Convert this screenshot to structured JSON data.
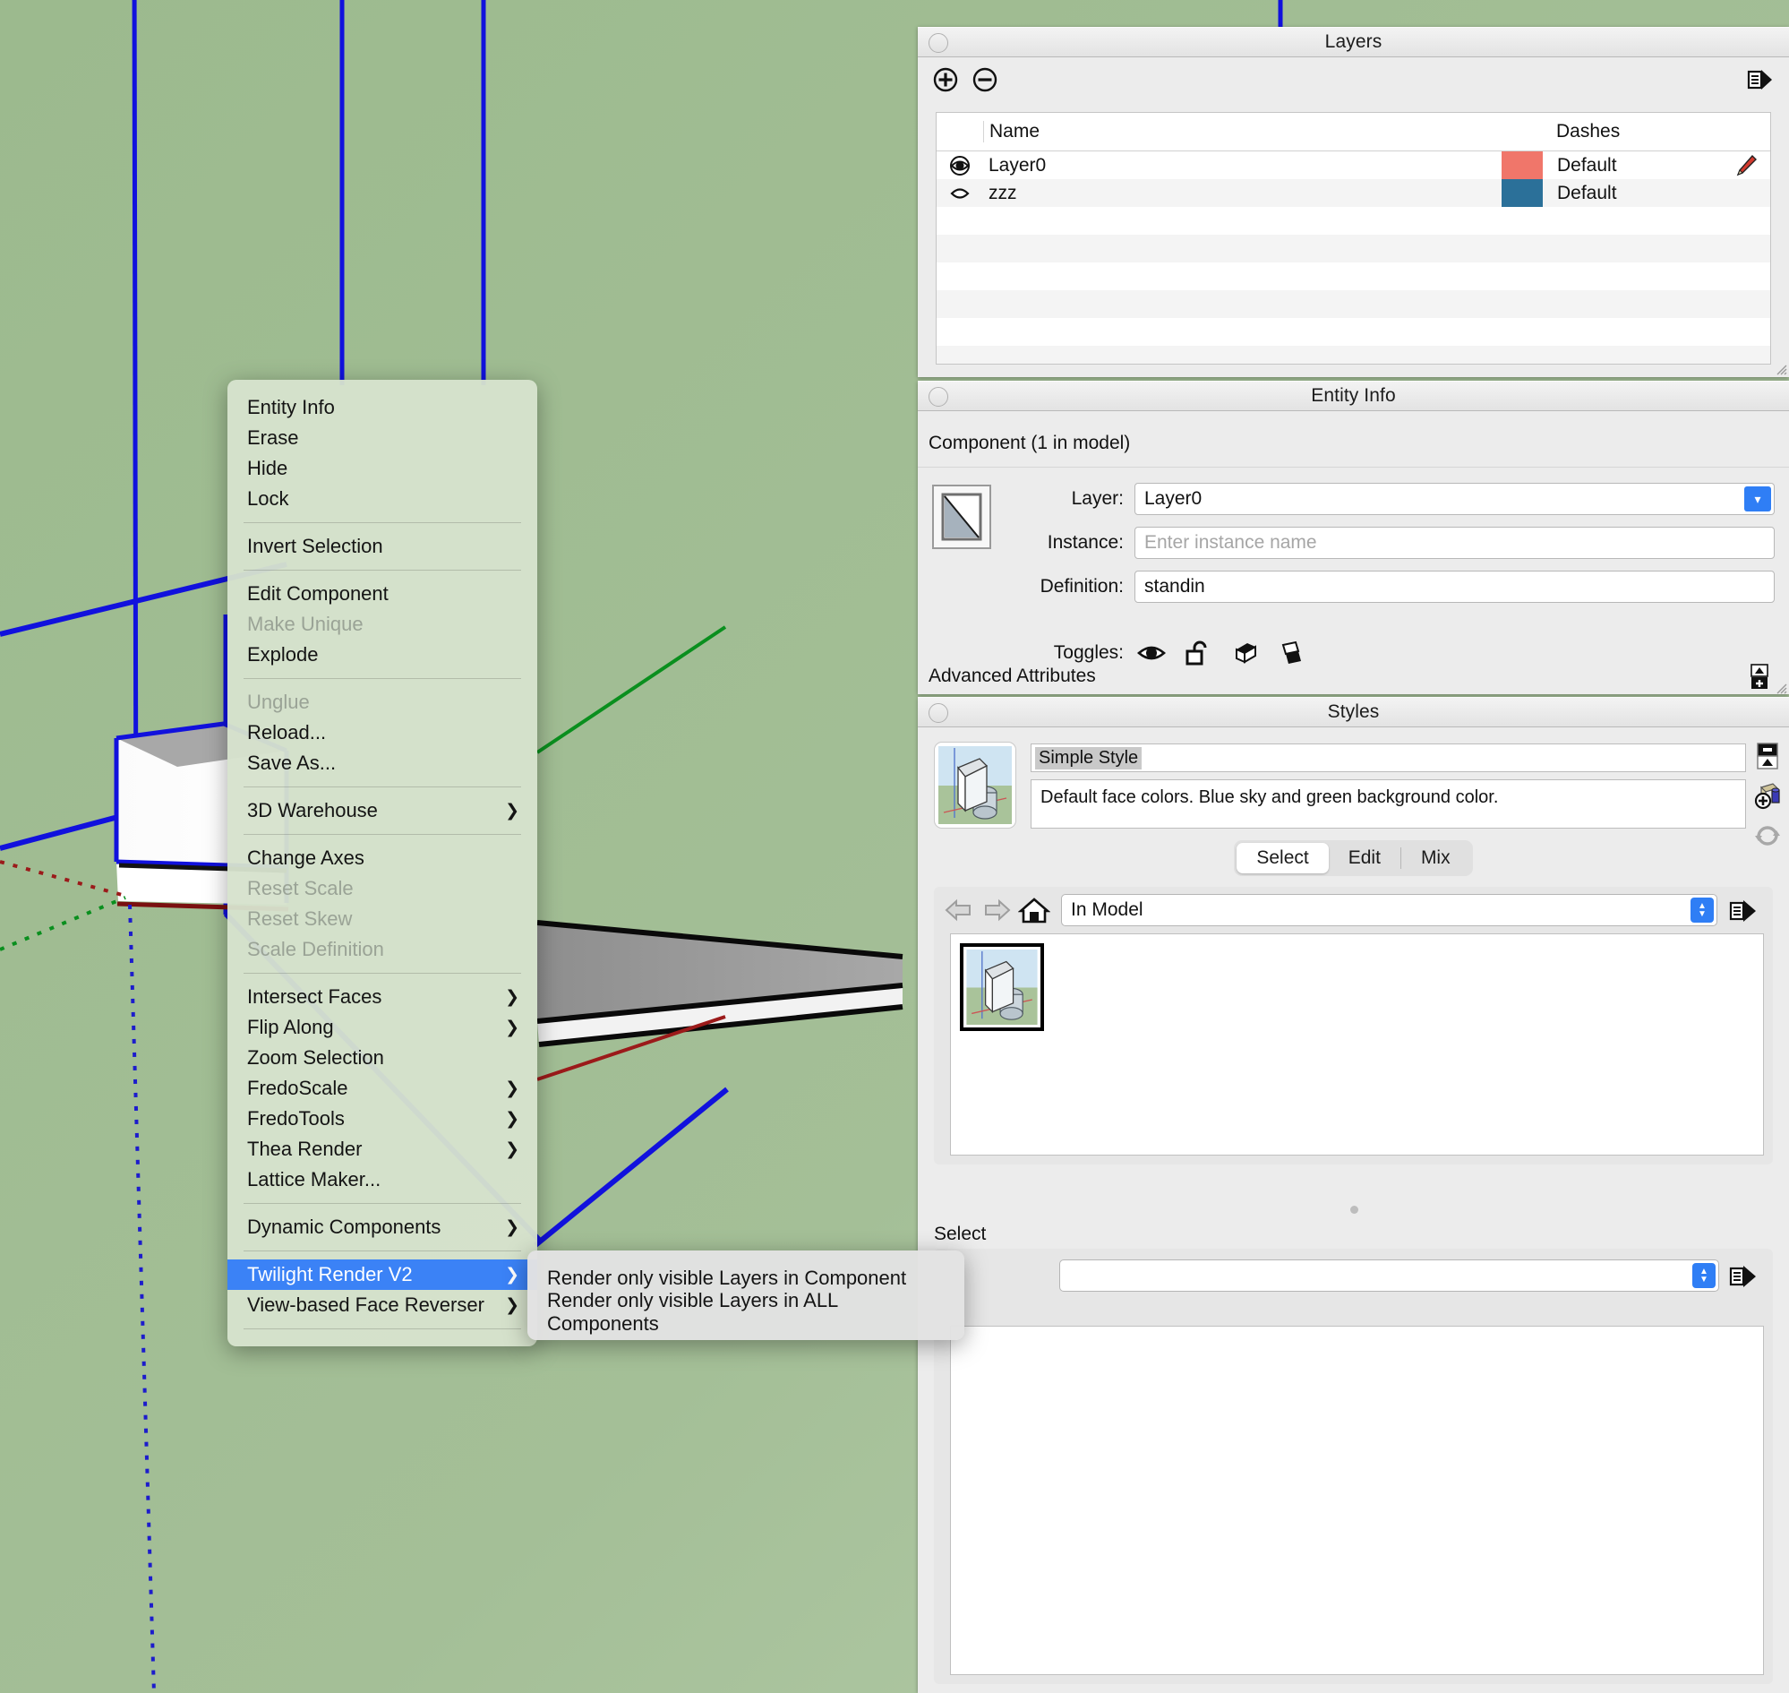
{
  "app": "SketchUp",
  "viewport": {
    "background_color": "#9cb98f",
    "selection_edge_color": "#0000ff",
    "axis_red": "#9b1a1a",
    "axis_green": "#0a8f1e",
    "axis_blue": "#1c1ccc"
  },
  "layers_panel": {
    "title": "Layers",
    "add_icon": "plus-circle-icon",
    "remove_icon": "minus-circle-icon",
    "options_icon": "list-options-icon",
    "columns": [
      "",
      "Name",
      "",
      "Dashes",
      ""
    ],
    "rows": [
      {
        "visible": true,
        "visibility_icon": "eye-filled-icon",
        "name": "Layer0",
        "color": "#f0766a",
        "dashes": "Default",
        "editing": true,
        "edit_icon": "pencil-icon"
      },
      {
        "visible": false,
        "visibility_icon": "eye-outline-icon",
        "name": "zzz",
        "color": "#2b7099",
        "dashes": "Default",
        "editing": false,
        "edit_icon": ""
      }
    ]
  },
  "entity_info_panel": {
    "title": "Entity Info",
    "type_label": "Component (1 in model)",
    "thumbnail_icon": "face-thumbnail-icon",
    "fields": [
      {
        "label": "Layer:",
        "value": "Layer0",
        "placeholder": "",
        "kind": "combo"
      },
      {
        "label": "Instance:",
        "value": "",
        "placeholder": "Enter instance name",
        "kind": "text"
      },
      {
        "label": "Definition:",
        "value": "standin",
        "placeholder": "",
        "kind": "text"
      }
    ],
    "toggles_label": "Toggles:",
    "toggles": [
      "eye-icon",
      "unlock-icon",
      "cast-shadows-icon",
      "receive-shadows-icon"
    ],
    "advanced_attributes_label": "Advanced Attributes",
    "advanced_expand_icon": "expand-collapse-icon"
  },
  "styles_panel": {
    "title": "Styles",
    "thumbnail_icon": "style-preview-icon",
    "style_name": "Simple Style",
    "style_description": "Default face colors. Blue sky and green background color.",
    "side_buttons": [
      "display-settings-icon",
      "create-style-icon",
      "update-style-icon"
    ],
    "tabs": [
      {
        "label": "Select",
        "active": true
      },
      {
        "label": "Edit",
        "active": false
      },
      {
        "label": "Mix",
        "active": false
      }
    ],
    "nav_icons": [
      "back-arrow-icon",
      "forward-arrow-icon",
      "home-icon"
    ],
    "collection": "In Model",
    "details_icon": "list-options-icon",
    "grid_items": [
      {
        "name": "Simple Style",
        "selected": true,
        "icon": "style-preview-icon"
      }
    ],
    "lower_section_label": "Select",
    "lower_select_value": "",
    "lower_details_icon": "list-options-icon"
  },
  "context_menu": {
    "items": [
      {
        "label": "Entity Info",
        "enabled": true,
        "submenu": false,
        "separator_after": false
      },
      {
        "label": "Erase",
        "enabled": true,
        "submenu": false,
        "separator_after": false
      },
      {
        "label": "Hide",
        "enabled": true,
        "submenu": false,
        "separator_after": false
      },
      {
        "label": "Lock",
        "enabled": true,
        "submenu": false,
        "separator_after": true
      },
      {
        "label": "Invert Selection",
        "enabled": true,
        "submenu": false,
        "separator_after": true
      },
      {
        "label": "Edit Component",
        "enabled": true,
        "submenu": false,
        "separator_after": false
      },
      {
        "label": "Make Unique",
        "enabled": false,
        "submenu": false,
        "separator_after": false
      },
      {
        "label": "Explode",
        "enabled": true,
        "submenu": false,
        "separator_after": true
      },
      {
        "label": "Unglue",
        "enabled": false,
        "submenu": false,
        "separator_after": false
      },
      {
        "label": "Reload...",
        "enabled": true,
        "submenu": false,
        "separator_after": false
      },
      {
        "label": "Save As...",
        "enabled": true,
        "submenu": false,
        "separator_after": true
      },
      {
        "label": "3D Warehouse",
        "enabled": true,
        "submenu": true,
        "separator_after": true
      },
      {
        "label": "Change Axes",
        "enabled": true,
        "submenu": false,
        "separator_after": false
      },
      {
        "label": "Reset Scale",
        "enabled": false,
        "submenu": false,
        "separator_after": false
      },
      {
        "label": "Reset Skew",
        "enabled": false,
        "submenu": false,
        "separator_after": false
      },
      {
        "label": "Scale Definition",
        "enabled": false,
        "submenu": false,
        "separator_after": true
      },
      {
        "label": "Intersect Faces",
        "enabled": true,
        "submenu": true,
        "separator_after": false
      },
      {
        "label": "Flip Along",
        "enabled": true,
        "submenu": true,
        "separator_after": false
      },
      {
        "label": "Zoom Selection",
        "enabled": true,
        "submenu": false,
        "separator_after": false
      },
      {
        "label": "FredoScale",
        "enabled": true,
        "submenu": true,
        "separator_after": false
      },
      {
        "label": "FredoTools",
        "enabled": true,
        "submenu": true,
        "separator_after": false
      },
      {
        "label": "Thea Render",
        "enabled": true,
        "submenu": true,
        "separator_after": false
      },
      {
        "label": "Lattice Maker...",
        "enabled": true,
        "submenu": false,
        "separator_after": true
      },
      {
        "label": "Dynamic Components",
        "enabled": true,
        "submenu": true,
        "separator_after": true
      },
      {
        "label": "Twilight Render V2",
        "enabled": true,
        "submenu": true,
        "separator_after": false,
        "highlighted": true
      },
      {
        "label": "View-based Face Reverser",
        "enabled": true,
        "submenu": true,
        "separator_after": true
      }
    ],
    "highlight_color": "#3b82f6"
  },
  "context_submenu": {
    "parent": "Twilight Render V2",
    "items": [
      {
        "label": "Render only visible Layers in Component"
      },
      {
        "label": "Render only visible Layers in ALL Components"
      }
    ]
  }
}
